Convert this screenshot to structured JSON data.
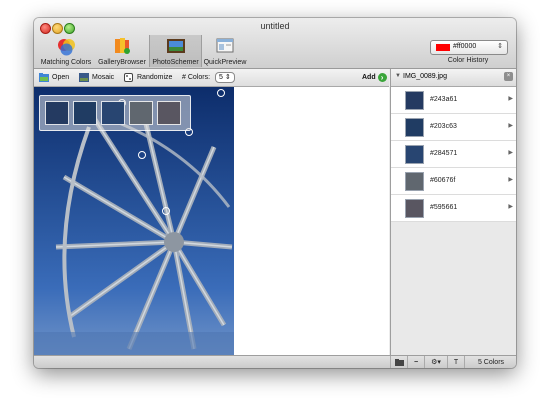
{
  "window": {
    "title": "untitled"
  },
  "toolbar": {
    "items": [
      {
        "label": "Matching Colors",
        "icon": "matching-colors-icon"
      },
      {
        "label": "GalleryBrowser",
        "icon": "gallery-browser-icon"
      },
      {
        "label": "PhotoSchemer",
        "icon": "photo-schemer-icon",
        "selected": true
      },
      {
        "label": "QuickPreview",
        "icon": "quick-preview-icon"
      }
    ],
    "color_value": "#ff0000",
    "color_history_label": "Color History"
  },
  "subtoolbar": {
    "open_label": "Open",
    "mosaic_label": "Mosaic",
    "randomize_label": "Randomize",
    "colors_label": "# Colors:",
    "colors_value": "5",
    "add_label": "Add"
  },
  "image": {
    "name": "IMG_0089.jpg",
    "swatches": [
      "#243a61",
      "#203c63",
      "#284571",
      "#60676f",
      "#595661"
    ]
  },
  "palette": {
    "colors": [
      {
        "hex": "#243a61"
      },
      {
        "hex": "#203c63"
      },
      {
        "hex": "#284571"
      },
      {
        "hex": "#60676f"
      },
      {
        "hex": "#595661"
      }
    ]
  },
  "status": {
    "count_label": "5 Colors"
  }
}
